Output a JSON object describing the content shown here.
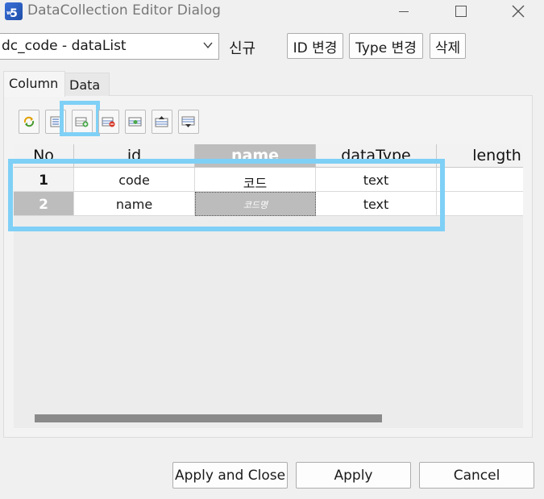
{
  "window": {
    "title": "DataCollection Editor Dialog",
    "icon_text": "5",
    "icon_small": "w"
  },
  "toolbar": {
    "select_value": "dc_code - dataList",
    "new_label": "신규",
    "id_change": "ID 변경",
    "type_change": "Type 변경",
    "delete": "삭제"
  },
  "tabs": [
    {
      "label": "Column",
      "active": true
    },
    {
      "label": "Data",
      "active": false
    }
  ],
  "tools": [
    {
      "icon": "refresh-icon"
    },
    {
      "icon": "list-icon"
    },
    {
      "icon": "add-row-icon"
    },
    {
      "icon": "delete-row-icon"
    },
    {
      "icon": "edit-row-icon"
    },
    {
      "icon": "move-up-icon"
    },
    {
      "icon": "move-down-icon"
    }
  ],
  "grid": {
    "columns": [
      "No",
      "id",
      "name",
      "dataType",
      "length"
    ],
    "rows": [
      {
        "no": "1",
        "id": "code",
        "name": "코드",
        "dataType": "text",
        "length": ""
      },
      {
        "no": "2",
        "id": "name",
        "name": "코드명",
        "dataType": "text",
        "length": ""
      }
    ]
  },
  "buttons": {
    "apply_close": "Apply and Close",
    "apply": "Apply",
    "cancel": "Cancel"
  },
  "colors": {
    "highlight": "#7fd0f6",
    "selected": "#bdbdbd"
  }
}
